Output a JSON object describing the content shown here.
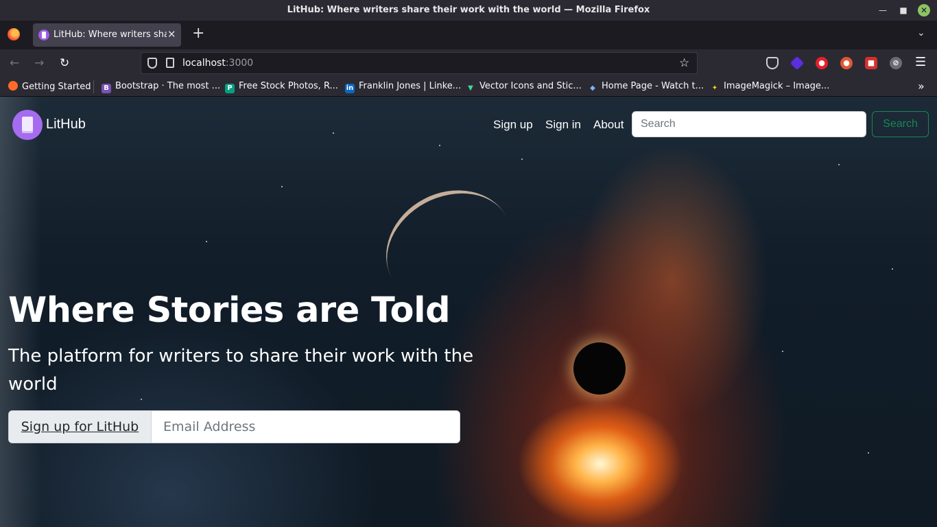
{
  "window": {
    "title": "LitHub: Where writers share their work with the world — Mozilla Firefox"
  },
  "tabs": [
    {
      "label": "LitHub: Where writers share their work with the world"
    }
  ],
  "address_bar": {
    "host": "localhost",
    "port": ":3000"
  },
  "bookmarks": [
    {
      "label": "Getting Started",
      "icon": "firefox-icon"
    },
    {
      "label": "Bootstrap · The most ...",
      "icon": "bootstrap-icon"
    },
    {
      "label": "Free Stock Photos, R...",
      "icon": "pexels-icon"
    },
    {
      "label": "Franklin Jones | Linke...",
      "icon": "linkedin-icon"
    },
    {
      "label": "Vector Icons and Stic...",
      "icon": "vector-icon"
    },
    {
      "label": "Home Page - Watch t...",
      "icon": "watch-icon"
    },
    {
      "label": "ImageMagick – Image...",
      "icon": "imagemagick-icon"
    }
  ],
  "site": {
    "brand": "LitHub",
    "nav": {
      "signup": "Sign up",
      "signin": "Sign in",
      "about": "About"
    },
    "search": {
      "placeholder": "Search",
      "button": "Search"
    },
    "hero": {
      "title": "Where Stories are Told",
      "subtitle": "The platform for writers to share their work with the world",
      "signup_button": "Sign up for LitHub",
      "email_placeholder": "Email Address"
    }
  },
  "colors": {
    "accent": "#198754",
    "brand": "#a66cf0",
    "chrome_dark": "#2b2a33"
  }
}
